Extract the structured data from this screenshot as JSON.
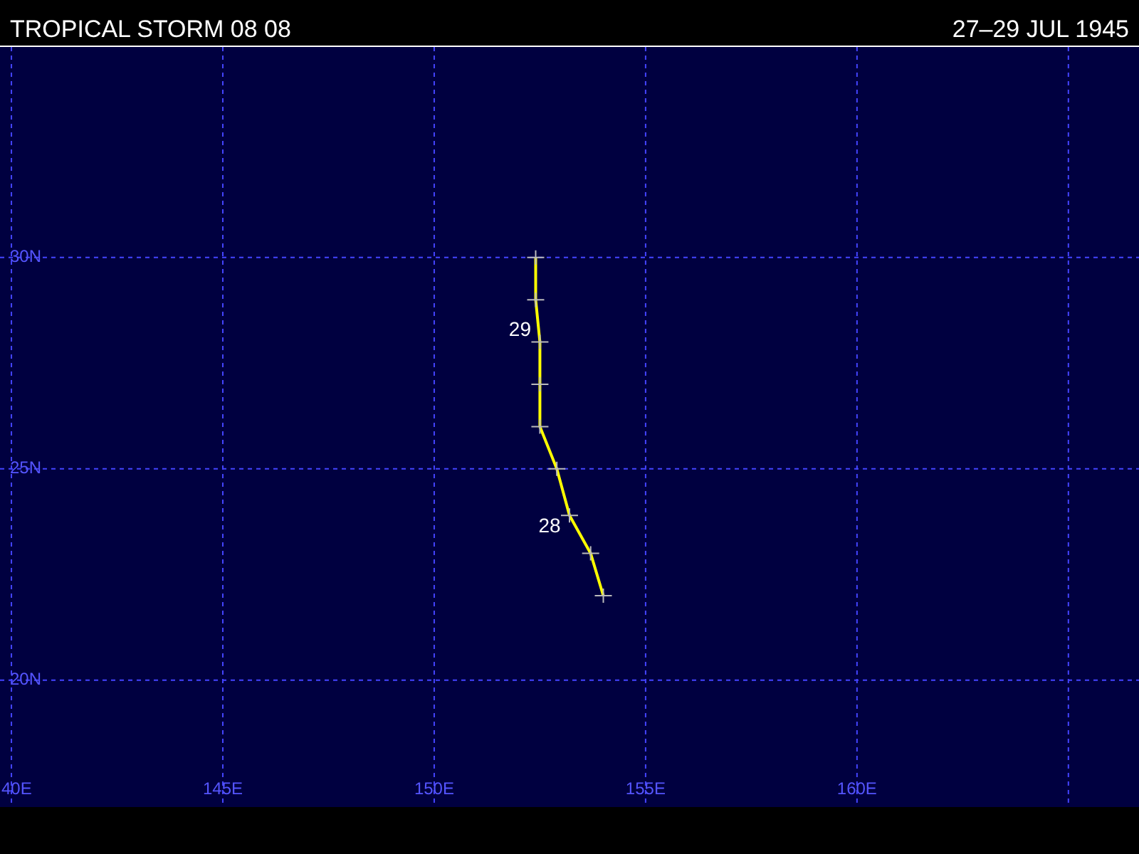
{
  "header": {
    "title": "TROPICAL STORM 08 08",
    "dates": "27–29 JUL 1945"
  },
  "map": {
    "edge_label": "40E",
    "chart_data": {
      "type": "line",
      "grid": true,
      "xlim": [
        139.73,
        166.67
      ],
      "ylim": [
        17.0,
        34.98
      ],
      "x": [
        154.0,
        153.7,
        153.2,
        152.9,
        152.5,
        152.5,
        152.5,
        152.4,
        152.4
      ],
      "series": [
        {
          "color": "#ffff00",
          "marker": "+",
          "values": [
            22.0,
            23.0,
            23.9,
            25.0,
            26.0,
            27.0,
            28.0,
            29.0,
            30.0
          ]
        }
      ],
      "xticks": [
        {
          "value": 145,
          "label": "145E"
        },
        {
          "value": 150,
          "label": "150E"
        },
        {
          "value": 155,
          "label": "155E"
        },
        {
          "value": 160,
          "label": "160E"
        }
      ],
      "yticks": [
        {
          "value": 20,
          "label": "20N"
        },
        {
          "value": 25,
          "label": "25N"
        },
        {
          "value": 30,
          "label": "30N"
        }
      ],
      "annotations": [
        {
          "text": "29",
          "x": 152.5,
          "y": 28.0
        },
        {
          "text": "28",
          "x": 153.2,
          "y": 23.9
        }
      ]
    }
  }
}
